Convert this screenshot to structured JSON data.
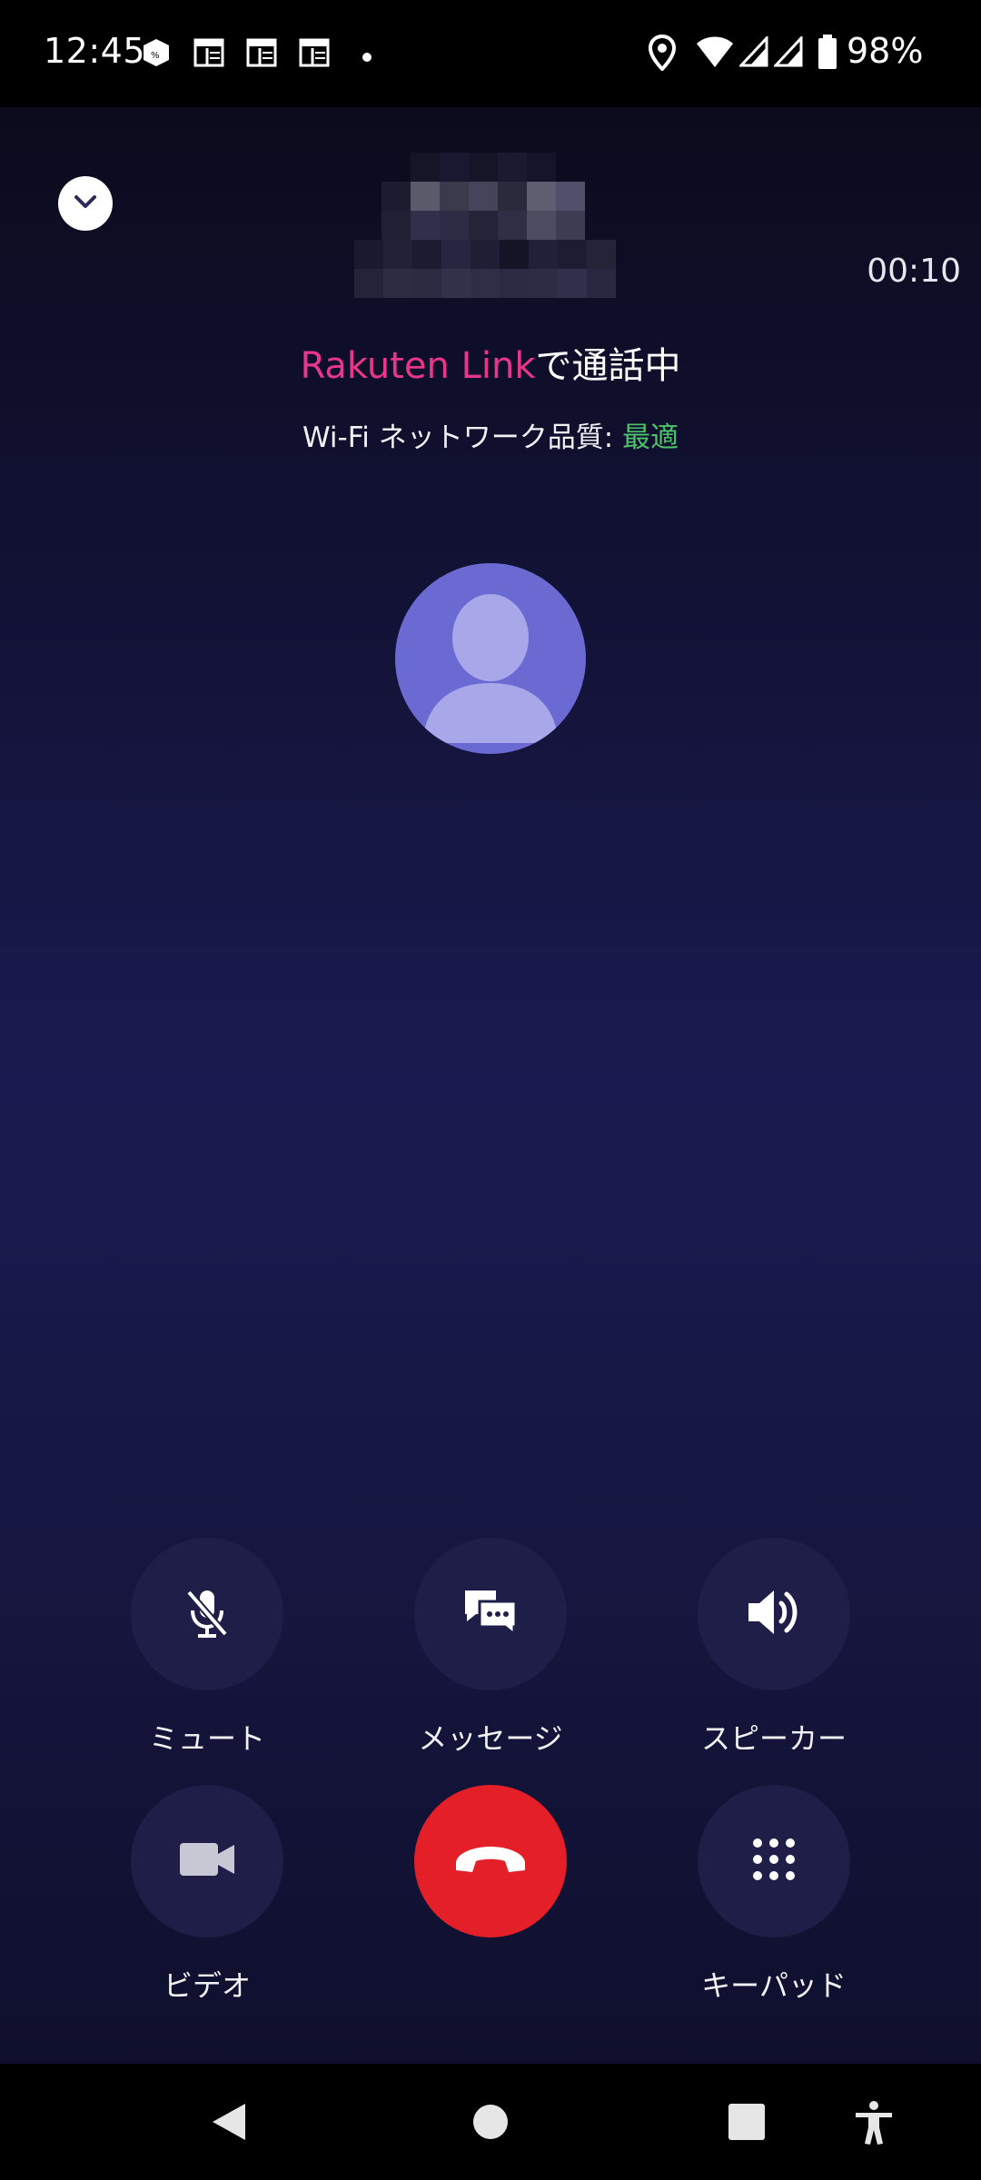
{
  "status_bar": {
    "time": "12:45",
    "battery_percent": "98%",
    "notification_icons": [
      "app-icon",
      "newspaper-icon",
      "newspaper-icon",
      "newspaper-icon",
      "dot-icon"
    ],
    "system_icons": [
      "location-icon",
      "wifi-icon",
      "signal-icon",
      "signal-icon",
      "battery-icon"
    ]
  },
  "call": {
    "duration": "00:10",
    "status_brand": "Rakuten Link",
    "status_suffix": "で通話中",
    "quality_label": "Wi-Fi ネットワーク品質: ",
    "quality_value": "最適"
  },
  "controls": {
    "mute_label": "ミュート",
    "message_label": "メッセージ",
    "speaker_label": "スピーカー",
    "video_label": "ビデオ",
    "keypad_label": "キーパッド"
  },
  "colors": {
    "brand": "#e8368a",
    "quality_good": "#4cc36a",
    "end_call": "#e41f28",
    "control_bg": "#1e1e48",
    "avatar_bg": "#6a6ad2"
  }
}
